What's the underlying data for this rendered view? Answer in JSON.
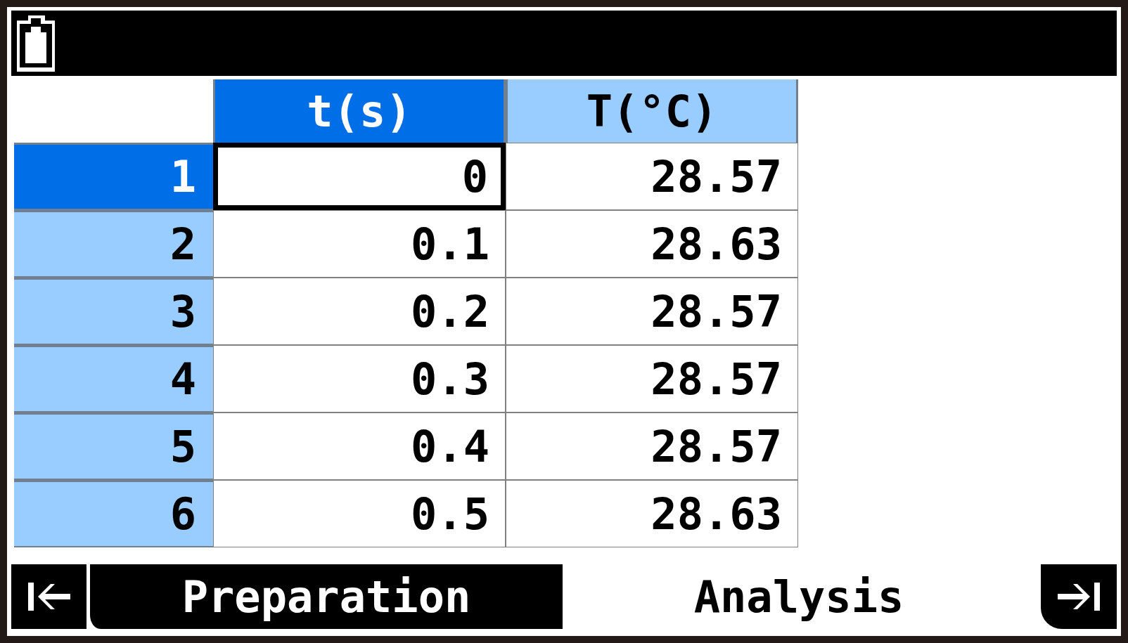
{
  "columns": [
    {
      "label": "t(s)",
      "selected": true
    },
    {
      "label": "T(°C)",
      "selected": false
    }
  ],
  "rows": [
    {
      "index": "1",
      "selected": true,
      "cells": [
        {
          "value": "0",
          "selected": true
        },
        {
          "value": "28.57",
          "selected": false
        }
      ]
    },
    {
      "index": "2",
      "selected": false,
      "cells": [
        {
          "value": "0.1",
          "selected": false
        },
        {
          "value": "28.63",
          "selected": false
        }
      ]
    },
    {
      "index": "3",
      "selected": false,
      "cells": [
        {
          "value": "0.2",
          "selected": false
        },
        {
          "value": "28.57",
          "selected": false
        }
      ]
    },
    {
      "index": "4",
      "selected": false,
      "cells": [
        {
          "value": "0.3",
          "selected": false
        },
        {
          "value": "28.57",
          "selected": false
        }
      ]
    },
    {
      "index": "5",
      "selected": false,
      "cells": [
        {
          "value": "0.4",
          "selected": false
        },
        {
          "value": "28.57",
          "selected": false
        }
      ]
    },
    {
      "index": "6",
      "selected": false,
      "cells": [
        {
          "value": "0.5",
          "selected": false
        },
        {
          "value": "28.63",
          "selected": false
        }
      ]
    }
  ],
  "tabs": [
    {
      "label": "Preparation",
      "selected": false
    },
    {
      "label": "Analysis",
      "selected": true
    }
  ]
}
